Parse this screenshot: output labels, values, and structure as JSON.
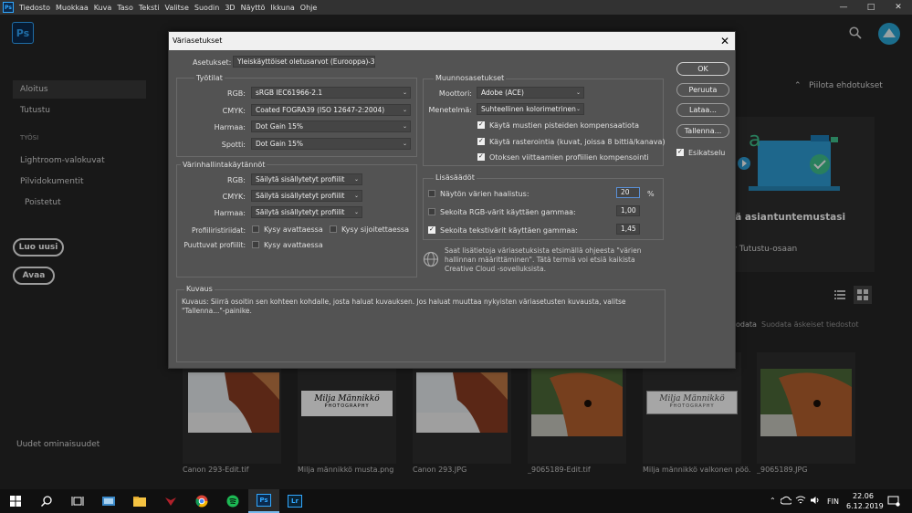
{
  "menubar": {
    "logo": "Ps",
    "items": [
      "Tiedosto",
      "Muokkaa",
      "Kuva",
      "Taso",
      "Teksti",
      "Valitse",
      "Suodin",
      "3D",
      "Näyttö",
      "Ikkuna",
      "Ohje"
    ],
    "window_controls": {
      "minimize": "—",
      "maximize": "□",
      "close": "✕"
    }
  },
  "home": {
    "ps_logo": "Ps",
    "sidebar": {
      "home": "Aloitus",
      "learn": "Tutustu",
      "work_header": "TYÖSI",
      "lightroom": "Lightroom-valokuvat",
      "cloud": "Pilvidokumentit",
      "deleted": "Poistetut",
      "new_button": "Luo uusi",
      "open_button": "Avaa",
      "features": "Uudet ominaisuudet"
    },
    "hide_suggestions": "Piilota ehdotukset",
    "promo_title": "ää asiantuntemustasi",
    "promo_sub": "ry Tutustu-osaan",
    "sort_label_partial": "odata",
    "recent_filter": "Suodata äskeiset tiedostot",
    "thumbnails": [
      {
        "caption": "Canon 293-Edit.tif"
      },
      {
        "caption": "Milja männikkö musta.png",
        "logo_line1": "Milja Männikkö",
        "logo_line2": "PHOTOGRAPHY"
      },
      {
        "caption": "Canon 293.JPG"
      },
      {
        "caption": "_9065189-Edit.tif"
      },
      {
        "caption": "Milja männikkö valkonen pöö...",
        "logo_line1": "Milja Männikkö",
        "logo_line2": "PHOTOGRAPHY"
      },
      {
        "caption": "_9065189.JPG"
      }
    ]
  },
  "taskbar": {
    "language": "FIN",
    "time": "22.06",
    "date": "6.12.2019",
    "ps_label": "Ps",
    "lr_label": "Lr"
  },
  "dialog": {
    "title": "Väriasetukset",
    "close": "✕",
    "settings_label": "Asetukset:",
    "settings_value": "Yleiskäyttöiset oletusarvot (Eurooppa) 3",
    "working_spaces": {
      "title": "Työtilat",
      "rgb_label": "RGB:",
      "rgb_value": "sRGB IEC61966-2.1",
      "cmyk_label": "CMYK:",
      "cmyk_value": "Coated FOGRA39 (ISO 12647-2:2004)",
      "gray_label": "Harmaa:",
      "gray_value": "Dot Gain 15%",
      "spot_label": "Spotti:",
      "spot_value": "Dot Gain 15%"
    },
    "policies": {
      "title": "Värinhallintakäytännöt",
      "rgb_label": "RGB:",
      "rgb_value": "Säilytä sisällytetyt profiilit",
      "cmyk_label": "CMYK:",
      "cmyk_value": "Säilytä sisällytetyt profiilit",
      "gray_label": "Harmaa:",
      "gray_value": "Säilytä sisällytetyt profiilit",
      "mismatch_label": "Profiiliristiriidat:",
      "ask_open": "Kysy avattaessa",
      "ask_paste": "Kysy sijoitettaessa",
      "missing_label": "Puuttuvat profiilit:",
      "ask_open_missing": "Kysy avattaessa"
    },
    "conversion": {
      "title": "Muunnosasetukset",
      "engine_label": "Moottori:",
      "engine_value": "Adobe (ACE)",
      "intent_label": "Menetelmä:",
      "intent_value": "Suhteellinen kolorimetrinen",
      "bpc": "Käytä mustien pisteiden kompensaatiota",
      "dither": "Käytä rasterointia (kuvat, joissa 8 bittiä/kanava)",
      "scene": "Otoksen viittaamien profiilien kompensointi"
    },
    "advanced": {
      "title": "Lisäsäädöt",
      "desaturate": "Näytön värien haalistus:",
      "desaturate_value": "20",
      "percent": "%",
      "blend_rgb": "Sekoita RGB-värit käyttäen gammaa:",
      "blend_rgb_value": "1,00",
      "blend_text": "Sekoita tekstivärit käyttäen gammaa:",
      "blend_text_value": "1,45"
    },
    "info_text": "Saat lisätietoja väriasetuksista etsimällä ohjeesta \"värien hallinnan määrittäminen\". Tätä termiä voi etsiä kaikista Creative Cloud -sovelluksista.",
    "description": {
      "title": "Kuvaus",
      "text": "Kuvaus: Siirrä osoitin sen kohteen kohdalle, josta haluat kuvauksen. Jos haluat muuttaa nykyisten väriasetusten kuvausta, valitse \"Tallenna...\"-painike."
    },
    "buttons": {
      "ok": "OK",
      "cancel": "Peruuta",
      "load": "Lataa...",
      "save": "Tallenna...",
      "preview": "Esikatselu"
    }
  }
}
